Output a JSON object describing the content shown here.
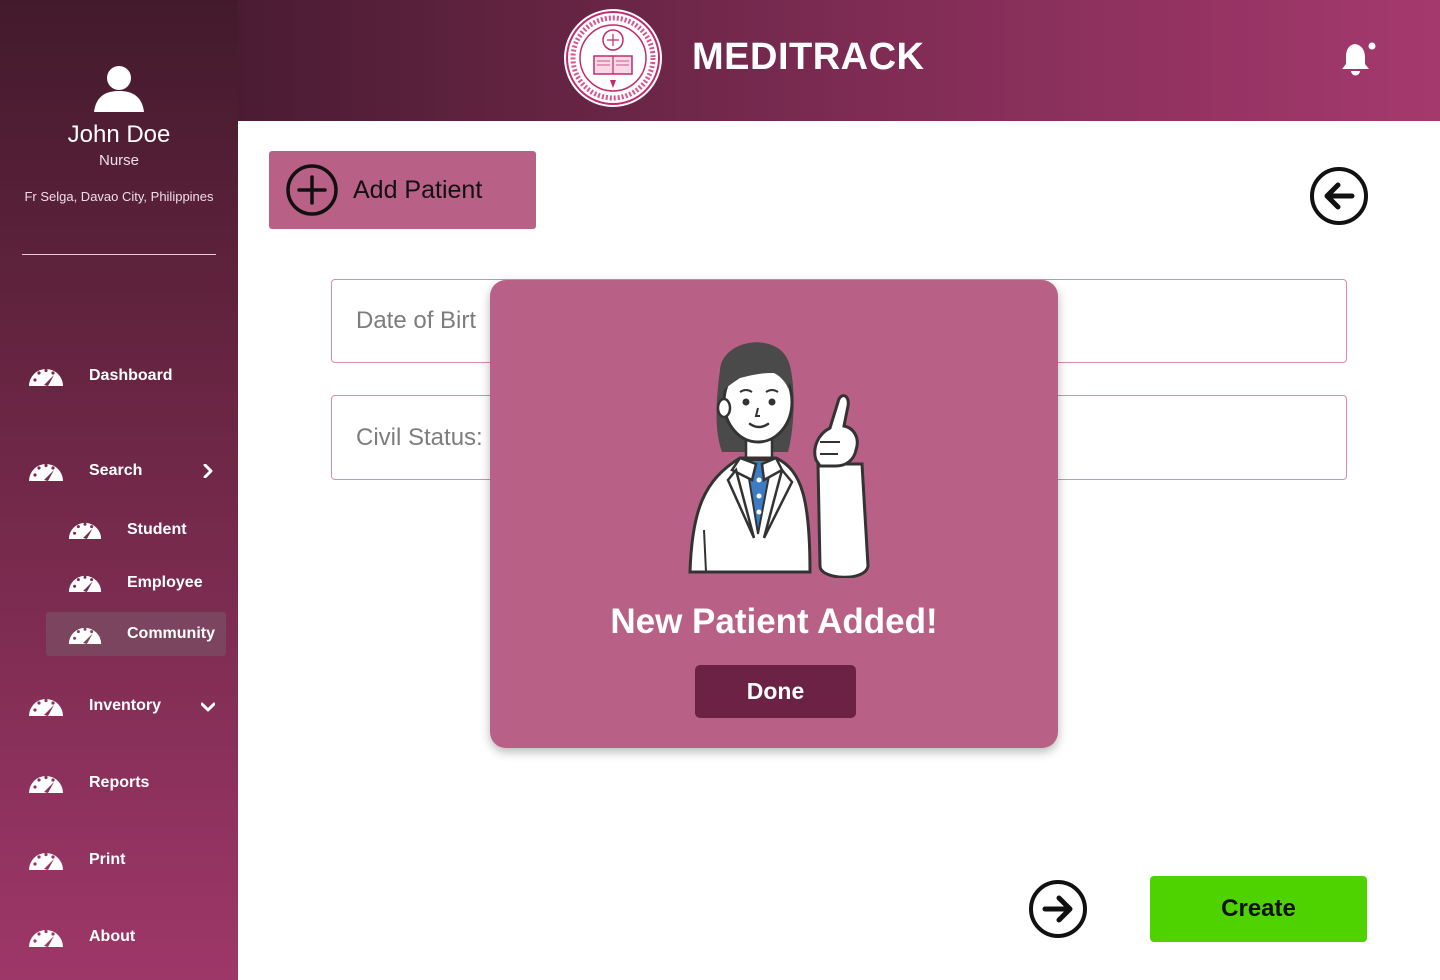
{
  "app": {
    "title": "MEDITRACK"
  },
  "user": {
    "name": "John Doe",
    "role": "Nurse",
    "location": "Fr Selga, Davao City, Philippines"
  },
  "sidebar": {
    "items": [
      {
        "label": "Dashboard",
        "icon": "gauge-icon"
      },
      {
        "label": "Search",
        "icon": "gauge-icon",
        "chevron": "chevron-right-icon"
      },
      {
        "label": "Student",
        "icon": "gauge-icon",
        "sub": true
      },
      {
        "label": "Employee",
        "icon": "gauge-icon",
        "sub": true
      },
      {
        "label": "Community",
        "icon": "gauge-icon",
        "sub": true,
        "active": true
      },
      {
        "label": "Inventory",
        "icon": "gauge-icon",
        "chevron": "chevron-down-icon"
      },
      {
        "label": "Reports",
        "icon": "gauge-icon"
      },
      {
        "label": "Print",
        "icon": "gauge-icon"
      },
      {
        "label": "About",
        "icon": "gauge-icon"
      }
    ]
  },
  "header": {
    "bell_icon": "bell-icon",
    "logo": "university-seal"
  },
  "main": {
    "add_patient_label": "Add Patient",
    "fields": {
      "dob_placeholder": "Date of Birth",
      "dob_visible": "Date of Birt",
      "civil_status_visible": "Civil Status:"
    },
    "create_label": "Create"
  },
  "modal": {
    "message": "New Patient Added!",
    "done_label": "Done"
  },
  "colors": {
    "primary": "#b96087",
    "dark": "#6b2244",
    "sidebar_top": "#431a2c",
    "sidebar_bottom": "#9e3769",
    "create": "#4fd300",
    "field_border": "#e08aa8"
  }
}
